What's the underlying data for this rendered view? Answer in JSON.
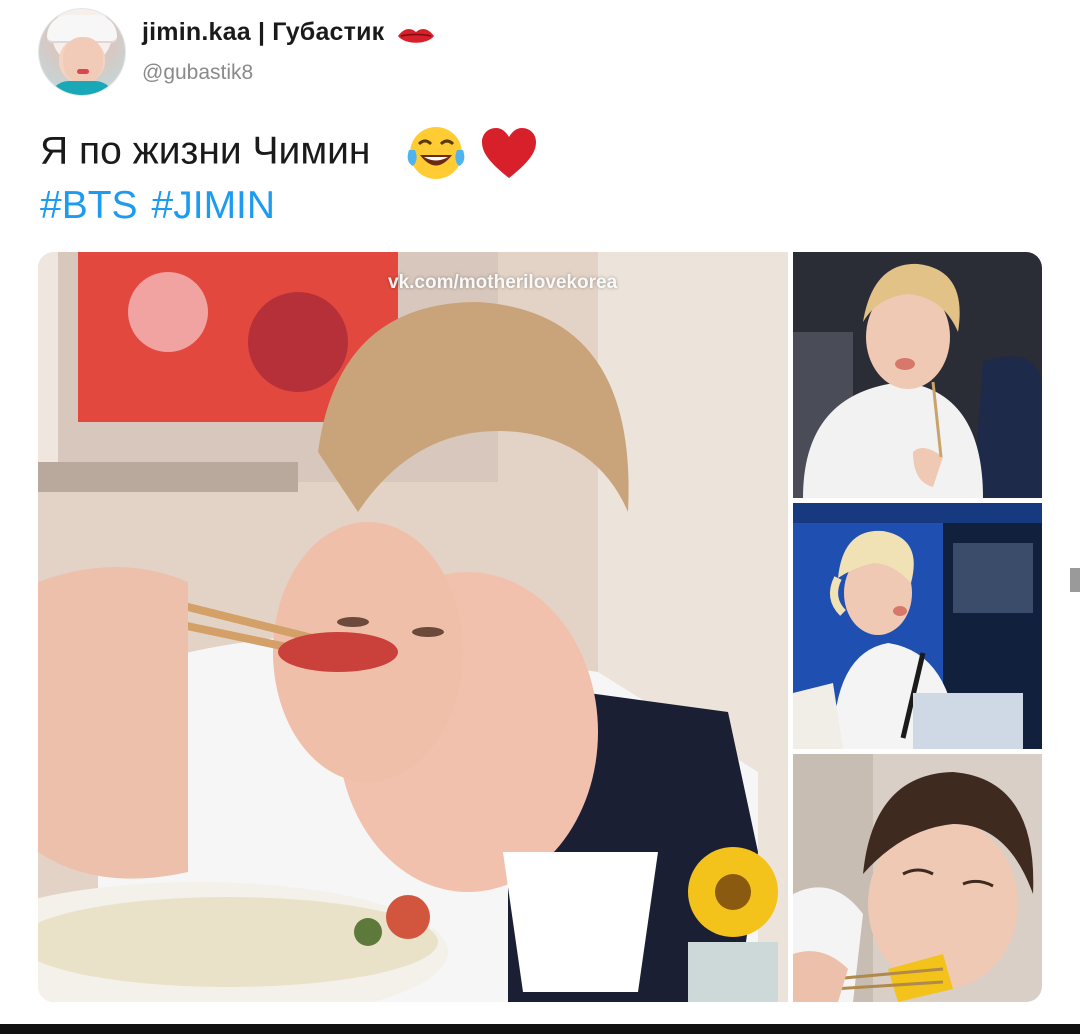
{
  "author": {
    "display_name": "jimin.kaa | Губастик",
    "handle": "@gubastik8",
    "name_emoji_icon": "lips-icon"
  },
  "tweet": {
    "text": "Я по жизни Чимин",
    "emojis": [
      "face-with-tears-of-joy-icon",
      "red-heart-icon"
    ],
    "hashtags": [
      "#BTS",
      "#JIMIN"
    ]
  },
  "media": {
    "watermark": "vk.com/motherilovekorea",
    "photo_count": 4
  },
  "colors": {
    "hashtag": "#1d9bf0",
    "heart": "#d8202a"
  }
}
